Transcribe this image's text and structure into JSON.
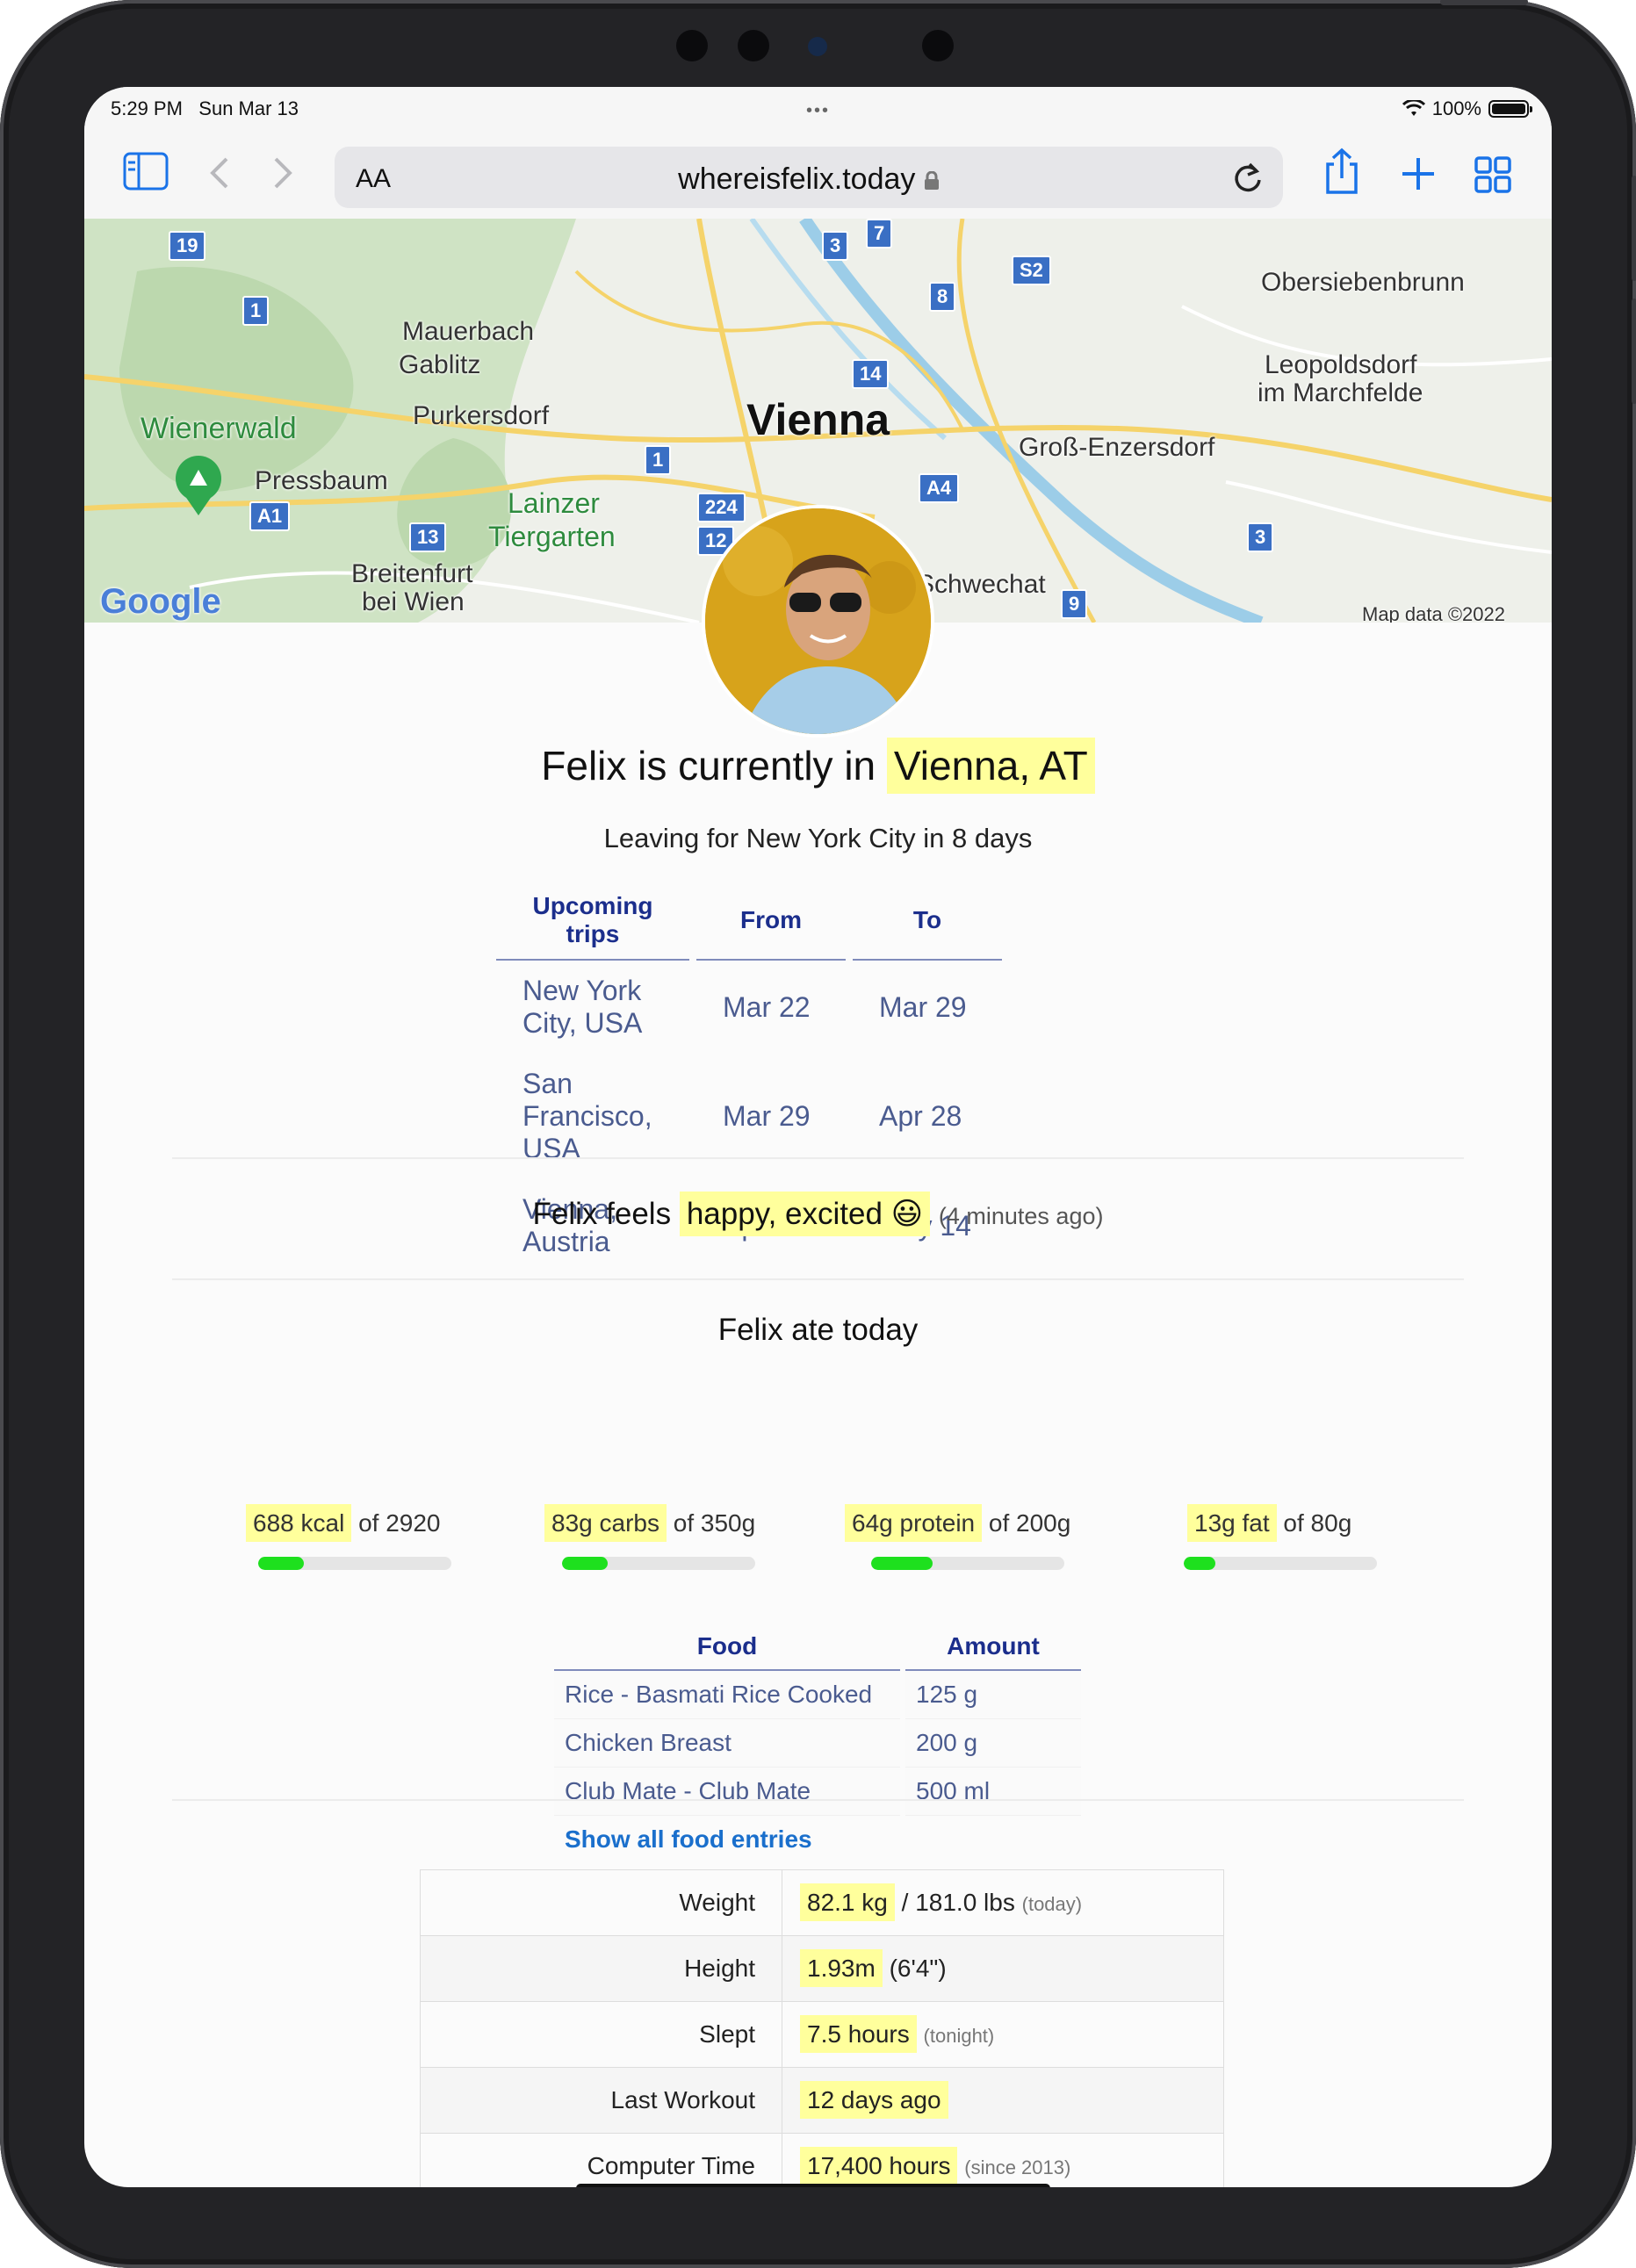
{
  "status": {
    "time": "5:29 PM",
    "date": "Sun Mar 13",
    "battery": "100%"
  },
  "browser": {
    "aa": "AA",
    "url": "whereisfelix.today"
  },
  "map": {
    "labels": [
      "Mauerbach",
      "Gablitz",
      "Purkersdorf",
      "Wienerwald",
      "Pressbaum",
      "Lainzer",
      "Tiergarten",
      "Breitenfurt",
      "bei Wien",
      "Vienna",
      "Obersiebenbrunn",
      "Leopoldsdorf",
      "im Marchfelde",
      "Groß-Enzersdorf",
      "Schwechat",
      "Map data ©2022"
    ],
    "shields": [
      "19",
      "1",
      "3",
      "7",
      "S2",
      "8",
      "14",
      "1",
      "A1",
      "13",
      "224",
      "12",
      "A4",
      "3",
      "9"
    ],
    "google": "Google"
  },
  "location": {
    "prefix": "Felix is currently in",
    "place": "Vienna, AT",
    "leaving": "Leaving for New York City in 8 days"
  },
  "trips": {
    "headers": [
      "Upcoming trips",
      "From",
      "To"
    ],
    "rows": [
      [
        "New York City, USA",
        "Mar 22",
        "Mar 29"
      ],
      [
        "San Francisco, USA",
        "Mar 29",
        "Apr 28"
      ],
      [
        "Vienna, Austria",
        "Apr 28",
        "May 14"
      ]
    ]
  },
  "mood": {
    "prefix": "Felix feels",
    "value": "happy, excited 😃",
    "ago": "(4 minutes ago)"
  },
  "food": {
    "title": "Felix ate today",
    "macros": [
      {
        "value": "688 kcal",
        "of": "of 2920",
        "pct": 0.236
      },
      {
        "value": "83g carbs",
        "of": "of 350g",
        "pct": 0.237
      },
      {
        "value": "64g protein",
        "of": "of 200g",
        "pct": 0.32
      },
      {
        "value": "13g fat",
        "of": "of 80g",
        "pct": 0.163
      }
    ],
    "headers": [
      "Food",
      "Amount"
    ],
    "rows": [
      [
        "Rice - Basmati Rice Cooked",
        "125 g"
      ],
      [
        "Chicken Breast",
        "200 g"
      ],
      [
        "Club Mate - Club Mate",
        "500 ml"
      ]
    ],
    "show_all": "Show all food entries"
  },
  "stats": [
    {
      "key": "Weight",
      "value": "82.1 kg",
      "extra": "/ 181.0 lbs",
      "note": "(today)"
    },
    {
      "key": "Height",
      "value": "1.93m",
      "extra": "(6'4\")",
      "note": ""
    },
    {
      "key": "Slept",
      "value": "7.5 hours",
      "extra": "",
      "note": "(tonight)"
    },
    {
      "key": "Last Workout",
      "value": "12 days ago",
      "extra": "",
      "note": ""
    },
    {
      "key": "Computer Time",
      "value": "17,400 hours",
      "extra": "",
      "note": "(since 2013)"
    }
  ],
  "colors": {
    "highlight": "#ffff9c",
    "table_header": "#1b2e8c",
    "table_text": "#4a5b8f",
    "progress": "#1ee01e",
    "link": "#1a6fcc"
  }
}
